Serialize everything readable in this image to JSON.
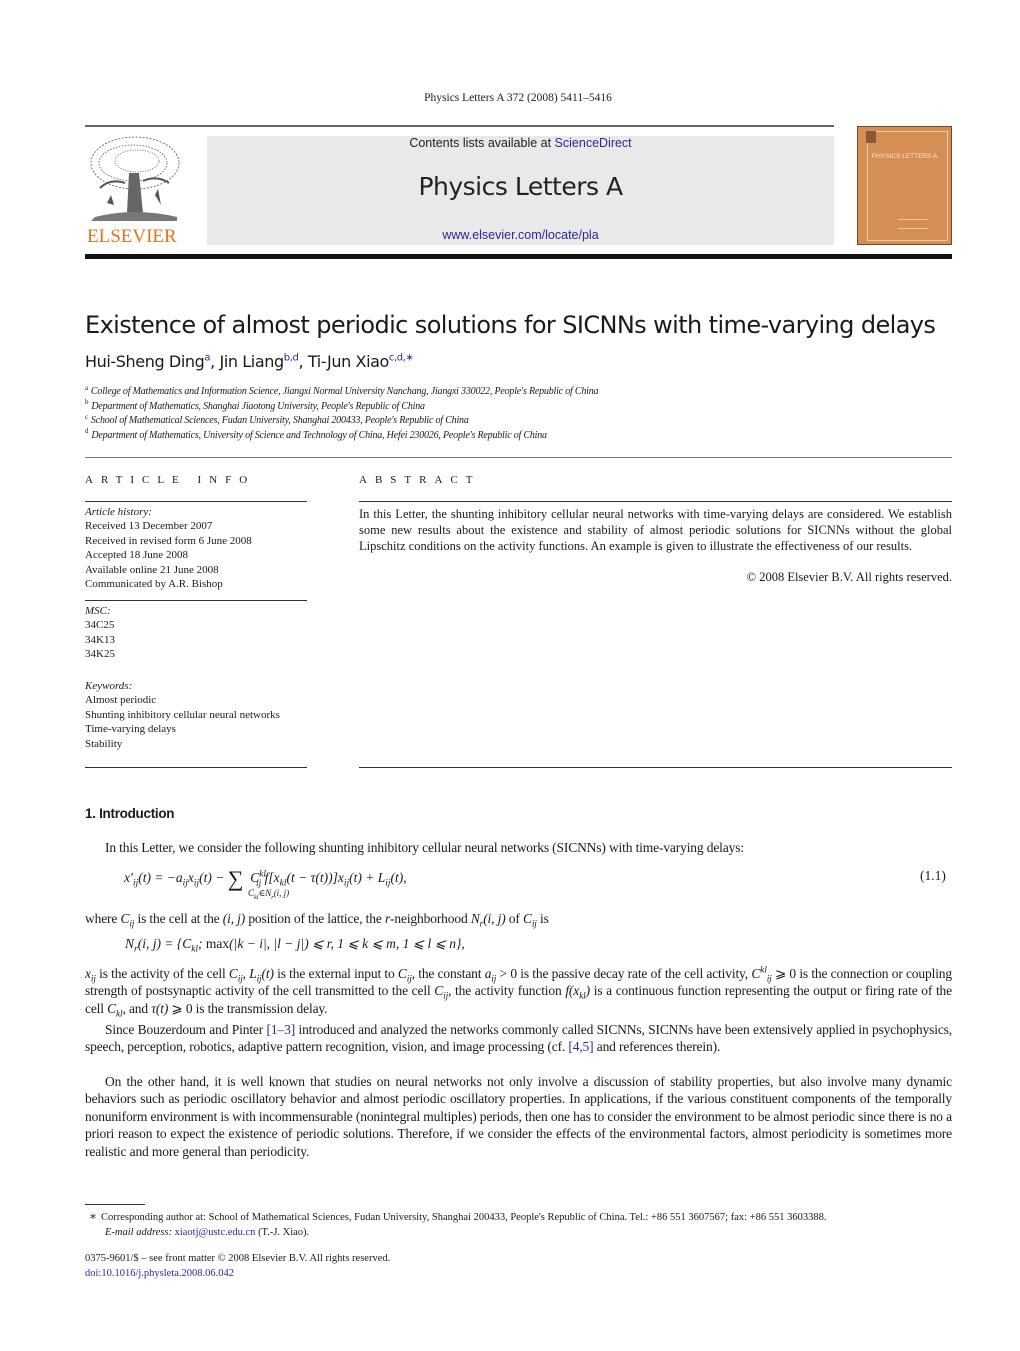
{
  "header": {
    "running_head": "Physics Letters A 372 (2008) 5411–5416",
    "contents_prefix": "Contents lists available at ",
    "contents_link": "ScienceDirect",
    "journal_title": "Physics Letters A",
    "journal_url": "www.elsevier.com/locate/pla",
    "publisher_logo": "ELSEVIER",
    "cover_title": "PHYSICS LETTERS A",
    "colors": {
      "publisher_orange": "#e8711a",
      "cover_bg": "#d58f55",
      "link_blue": "#2a2a9a",
      "masthead_bg": "#e9e9e9"
    }
  },
  "article": {
    "title": "Existence of almost periodic solutions for SICNNs with time-varying delays",
    "authors": [
      {
        "name": "Hui-Sheng Ding",
        "sup": "a"
      },
      {
        "name": "Jin Liang",
        "sup": "b,d"
      },
      {
        "name": "Ti-Jun Xiao",
        "sup": "c,d,∗"
      }
    ],
    "affiliations": [
      {
        "key": "a",
        "text": "College of Mathematics and Information Science, Jiangxi Normal University Nanchang, Jiangxi 330022, People's Republic of China"
      },
      {
        "key": "b",
        "text": "Department of Mathematics, Shanghai Jiaotong University, People's Republic of China"
      },
      {
        "key": "c",
        "text": "School of Mathematical Sciences, Fudan University, Shanghai 200433, People's Republic of China"
      },
      {
        "key": "d",
        "text": "Department of Mathematics, University of Science and Technology of China, Hefei 230026, People's Republic of China"
      }
    ]
  },
  "article_info": {
    "heading": "ARTICLE INFO",
    "history_label": "Article history:",
    "history": [
      "Received 13 December 2007",
      "Received in revised form 6 June 2008",
      "Accepted 18 June 2008",
      "Available online 21 June 2008",
      "Communicated by A.R. Bishop"
    ],
    "msc_label": "MSC:",
    "msc": [
      "34C25",
      "34K13",
      "34K25"
    ],
    "keywords_label": "Keywords:",
    "keywords": [
      "Almost periodic",
      "Shunting inhibitory cellular neural networks",
      "Time-varying delays",
      "Stability"
    ]
  },
  "abstract": {
    "heading": "ABSTRACT",
    "text": "In this Letter, the shunting inhibitory cellular neural networks with time-varying delays are considered. We establish some new results about the existence and stability of almost periodic solutions for SICNNs without the global Lipschitz conditions on the activity functions. An example is given to illustrate the effectiveness of our results.",
    "copyright": "© 2008 Elsevier B.V. All rights reserved."
  },
  "intro": {
    "heading": "1. Introduction",
    "p1": "In this Letter, we consider the following shunting inhibitory cellular neural networks (SICNNs) with time-varying delays:",
    "eq1_number": "(1.1)",
    "p2_a": "where ",
    "p2_b": " is the cell at the ",
    "p2_c": " position of the lattice, the ",
    "p2_d": "-neighborhood ",
    "p2_e": " of ",
    "p2_f": " is",
    "p3_parts": [
      " is the activity of the cell ",
      " is the external input to ",
      ", the constant ",
      " is the passive decay rate of the cell activity, ",
      " is the connection or coupling strength of postsynaptic activity of the cell transmitted to the cell ",
      ", the activity function ",
      " is a continuous function representing the output or firing rate of the cell ",
      ", and ",
      " is the transmission delay."
    ],
    "p4_a": "Since Bouzerdoum and Pinter ",
    "p4_ref1": "[1–3]",
    "p4_b": " introduced and analyzed the networks commonly called SICNNs, SICNNs have been extensively applied in psychophysics, speech, perception, robotics, adaptive pattern recognition, vision, and image processing (cf. ",
    "p4_ref2": "[4,5]",
    "p4_c": " and references therein).",
    "p5": "On the other hand, it is well known that studies on neural networks not only involve a discussion of stability properties, but also involve many dynamic behaviors such as periodic oscillatory behavior and almost periodic oscillatory properties. In applications, if the various constituent components of the temporally nonuniform environment is with incommensurable (nonintegral multiples) periods, then one has to consider the environment to be almost periodic since there is no a priori reason to expect the existence of periodic solutions. Therefore, if we consider the effects of the environmental factors, almost periodicity is sometimes more realistic and more general than periodicity."
  },
  "footnote": {
    "marker": "∗",
    "text": "Corresponding author at: School of Mathematical Sciences, Fudan University, Shanghai 200433, People's Republic of China. Tel.: +86 551 3607567; fax: +86 551 3603388.",
    "email_label": "E-mail address:",
    "email": "xiaotj@ustc.edu.cn",
    "email_suffix": " (T.-J. Xiao)."
  },
  "bottom": {
    "issn": "0375-9601/$ – see front matter  © 2008 Elsevier B.V. All rights reserved.",
    "doi": "doi:10.1016/j.physleta.2008.06.042"
  }
}
